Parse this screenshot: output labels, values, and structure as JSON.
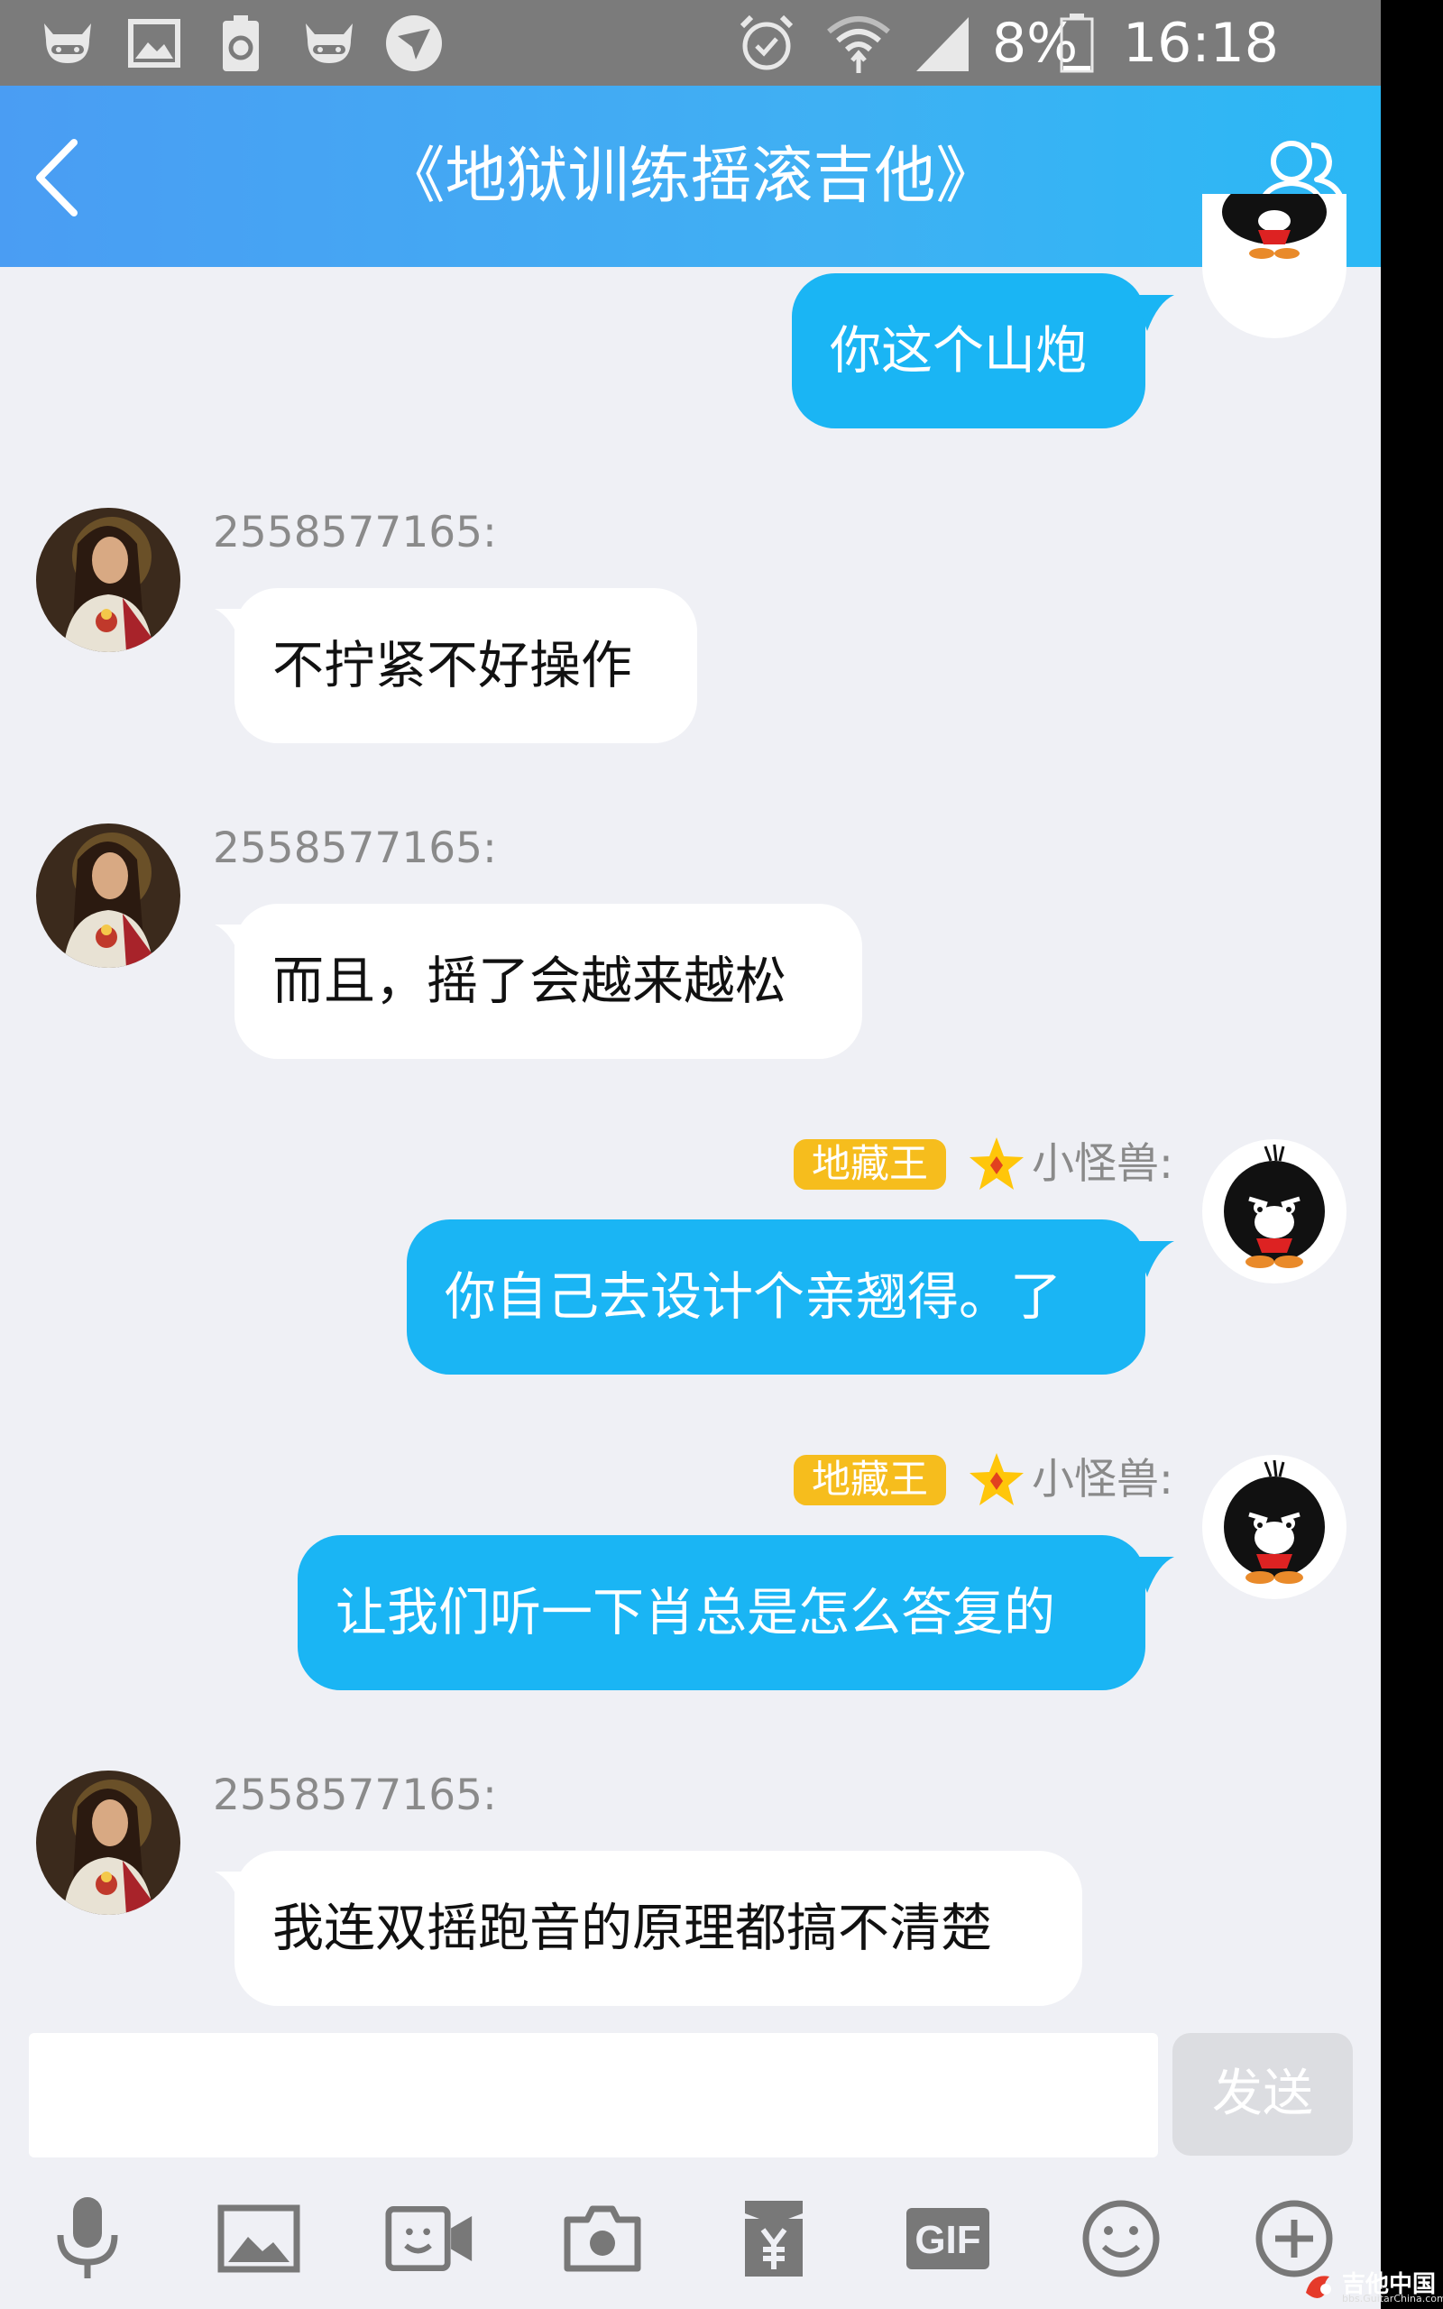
{
  "status_bar": {
    "battery_percent": "8%",
    "time": "16:18",
    "left_icons": [
      "cow-icon",
      "image-icon",
      "battery-recycle-icon",
      "cow-icon",
      "paper-plane-app-icon"
    ],
    "right_icons": [
      "alarm-icon",
      "wifi-icon",
      "signal-icon",
      "battery-icon"
    ]
  },
  "header": {
    "title": "《地狱训练摇滚吉他》",
    "back_icon": "chevron-left-icon",
    "members_icon": "group-members-icon"
  },
  "messages": [
    {
      "direction": "out",
      "text": "你这个山炮",
      "avatar": "penguin-monster-avatar"
    },
    {
      "direction": "in",
      "sender": "2558577165:",
      "text": "不拧紧不好操作",
      "avatar": "jesus-portrait-avatar"
    },
    {
      "direction": "in",
      "sender": "2558577165:",
      "text": "而且，摇了会越来越松",
      "avatar": "jesus-portrait-avatar"
    },
    {
      "direction": "out",
      "badge": "地藏王",
      "sender": "小怪兽:",
      "text": "你自己去设计个亲翘得。了",
      "avatar": "penguin-monster-avatar"
    },
    {
      "direction": "out",
      "badge": "地藏王",
      "sender": "小怪兽:",
      "text": "让我们听一下肖总是怎么答复的",
      "avatar": "penguin-monster-avatar"
    },
    {
      "direction": "in",
      "sender": "2558577165:",
      "text": "我连双摇跑音的原理都搞不清楚",
      "avatar": "jesus-portrait-avatar"
    }
  ],
  "input": {
    "value": "",
    "send_label": "发送"
  },
  "toolbar": [
    "microphone-icon",
    "image-icon",
    "video-call-icon",
    "camera-icon",
    "red-packet-yen-icon",
    "gif-icon",
    "emoji-icon",
    "plus-icon"
  ],
  "colors": {
    "header_start": "#4a9df3",
    "header_end": "#2bb8f5",
    "outgoing_bubble": "#1ab5f4",
    "incoming_bubble": "#ffffff",
    "background": "#eff0f5",
    "badge": "#f6bd1d",
    "status_bar": "#7b7b7b"
  },
  "watermark": {
    "logo_text": "吉他中国",
    "url": "bbs.GuitarChina.com"
  }
}
